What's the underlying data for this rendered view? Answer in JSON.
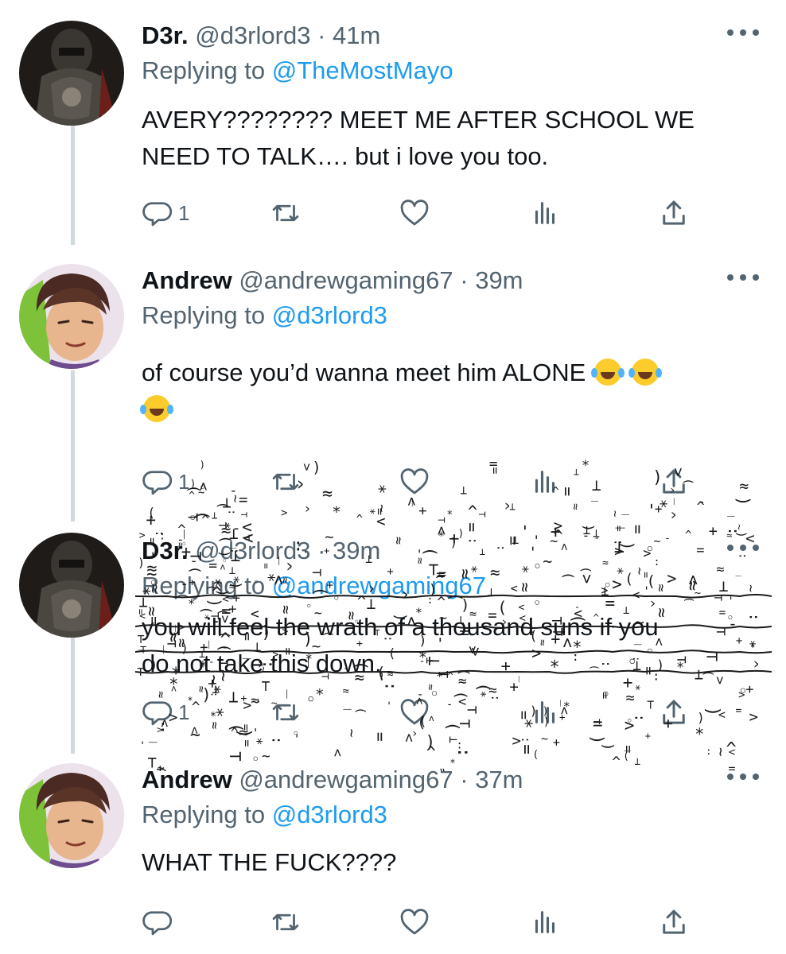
{
  "tweets": [
    {
      "name": "D3r.",
      "handle": "@d3rlord3",
      "dot": "·",
      "time": "41m",
      "replying_prefix": "Replying to ",
      "replying_to": "@TheMostMayo",
      "text_lines": [
        "AVERY???????? MEET ME AFTER SCHOOL WE",
        "NEED TO TALK…. but i love you too."
      ],
      "reply_count": "1"
    },
    {
      "name": "Andrew",
      "handle": "@andrewgaming67",
      "dot": "·",
      "time": "39m",
      "replying_prefix": "Replying to ",
      "replying_to": "@d3rlord3",
      "text": "of course you’d wanna meet him ALONE",
      "emojis": [
        "face-with-tears-of-joy",
        "face-with-tears-of-joy",
        "face-with-tears-of-joy"
      ],
      "reply_count": "1"
    },
    {
      "name": "D3r.",
      "handle": "@d3rlord3",
      "dot": "·",
      "time": "39m",
      "replying_prefix": "Replying to ",
      "replying_to": "@andrewgaming67",
      "text_lines": [
        "you will feel the wrath of a thousand suns if you",
        "do not take this down."
      ],
      "reply_count": "1"
    },
    {
      "name": "Andrew",
      "handle": "@andrewgaming67",
      "dot": "·",
      "time": "37m",
      "replying_prefix": "Replying to ",
      "replying_to": "@d3rlord3",
      "text": "WHAT THE FUCK????",
      "reply_count": ""
    }
  ],
  "colors": {
    "text": "#0f1419",
    "secondary": "#536471",
    "link": "#1d9bf0",
    "thread_line": "#cfd9de"
  },
  "icons": [
    "reply-icon",
    "retweet-icon",
    "like-icon",
    "analytics-icon",
    "share-icon",
    "more-icon",
    "face-with-tears-of-joy"
  ]
}
